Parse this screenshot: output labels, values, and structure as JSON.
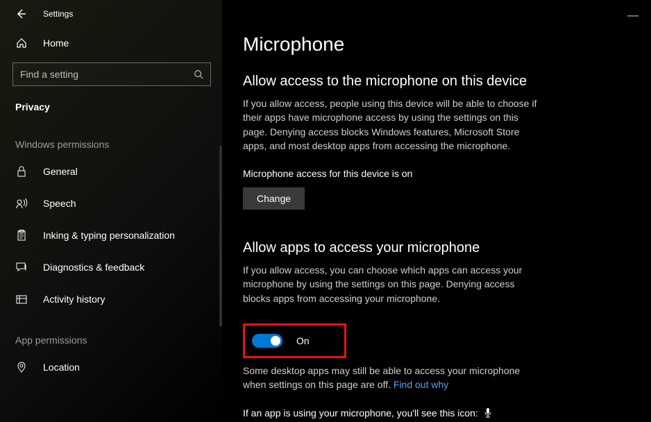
{
  "window": {
    "title": "Settings"
  },
  "sidebar": {
    "home": "Home",
    "search_placeholder": "Find a setting",
    "current_section": "Privacy",
    "group1_title": "Windows permissions",
    "items1": [
      {
        "label": "General"
      },
      {
        "label": "Speech"
      },
      {
        "label": "Inking & typing personalization"
      },
      {
        "label": "Diagnostics & feedback"
      },
      {
        "label": "Activity history"
      }
    ],
    "group2_title": "App permissions",
    "items2": [
      {
        "label": "Location"
      }
    ]
  },
  "main": {
    "heading": "Microphone",
    "section1": {
      "title": "Allow access to the microphone on this device",
      "desc": "If you allow access, people using this device will be able to choose if their apps have microphone access by using the settings on this page. Denying access blocks Windows features, Microsoft Store apps, and most desktop apps from accessing the microphone.",
      "status": "Microphone access for this device is on",
      "change_btn": "Change"
    },
    "section2": {
      "title": "Allow apps to access your microphone",
      "desc": "If you allow access, you can choose which apps can access your microphone by using the settings on this page. Denying access blocks apps from accessing your microphone.",
      "toggle_state": "On",
      "note_a": "Some desktop apps may still be able to access your microphone when settings on this page are off. ",
      "note_link": "Find out why",
      "icon_line": "If an app is using your microphone, you'll see this icon:"
    }
  }
}
